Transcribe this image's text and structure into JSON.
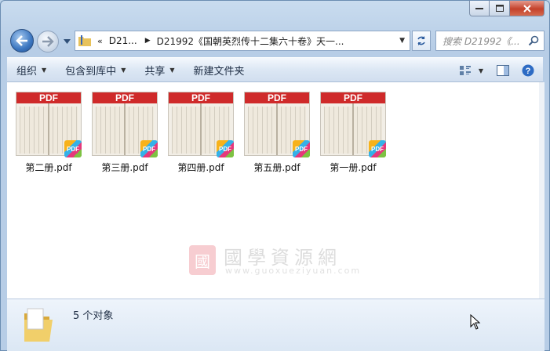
{
  "window": {
    "caption_buttons": [
      "minimize",
      "maximize",
      "close"
    ]
  },
  "address_bar": {
    "overflow_chevron": "«",
    "crumbs": [
      "D21...",
      "D21992《国朝英烈传十二集六十卷》天一..."
    ]
  },
  "search": {
    "placeholder": "搜索 D21992《..."
  },
  "command_bar": {
    "items": [
      {
        "label": "组织",
        "has_dropdown": true
      },
      {
        "label": "包含到库中",
        "has_dropdown": true
      },
      {
        "label": "共享",
        "has_dropdown": true
      },
      {
        "label": "新建文件夹",
        "has_dropdown": false
      }
    ]
  },
  "files": [
    {
      "name": "第二册.pdf",
      "thumb_label": "PDF",
      "badge": "PDF"
    },
    {
      "name": "第三册.pdf",
      "thumb_label": "PDF",
      "badge": "PDF"
    },
    {
      "name": "第四册.pdf",
      "thumb_label": "PDF",
      "badge": "PDF"
    },
    {
      "name": "第五册.pdf",
      "thumb_label": "PDF",
      "badge": "PDF"
    },
    {
      "name": "第一册.pdf",
      "thumb_label": "PDF",
      "badge": "PDF"
    }
  ],
  "watermark": {
    "seal": "國",
    "title": "國學資源網",
    "url": "www.guoxueziyuan.com"
  },
  "details": {
    "count_text": "5 个对象"
  },
  "colors": {
    "pdf_red": "#cf2a2a",
    "window_frame": "#b7cde6",
    "close_red": "#c4412b"
  }
}
